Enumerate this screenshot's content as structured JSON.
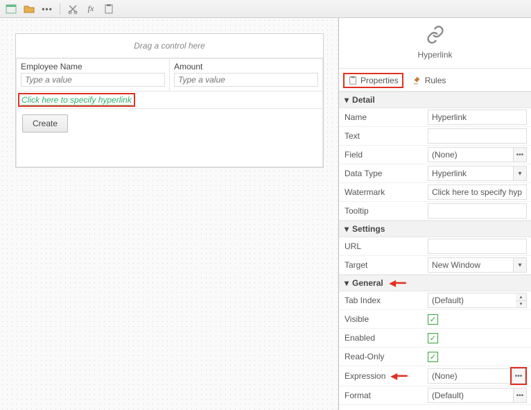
{
  "panel": {
    "title": "Hyperlink",
    "tabs": {
      "properties": "Properties",
      "rules": "Rules"
    }
  },
  "sections": {
    "detail": "Detail",
    "settings": "Settings",
    "general": "General"
  },
  "props": {
    "name": {
      "label": "Name",
      "value": "Hyperlink"
    },
    "text": {
      "label": "Text",
      "value": ""
    },
    "field": {
      "label": "Field",
      "value": "(None)"
    },
    "dataType": {
      "label": "Data Type",
      "value": "Hyperlink"
    },
    "watermark": {
      "label": "Watermark",
      "value": "Click here to specify hyp"
    },
    "tooltip": {
      "label": "Tooltip",
      "value": ""
    },
    "url": {
      "label": "URL",
      "value": ""
    },
    "target": {
      "label": "Target",
      "value": "New Window"
    },
    "tabIndex": {
      "label": "Tab Index",
      "value": "(Default)"
    },
    "visible": {
      "label": "Visible"
    },
    "enabled": {
      "label": "Enabled"
    },
    "readOnly": {
      "label": "Read-Only"
    },
    "expression": {
      "label": "Expression",
      "value": "(None)"
    },
    "format": {
      "label": "Format",
      "value": "(Default)"
    }
  },
  "canvas": {
    "dropHint": "Drag a control here",
    "fields": {
      "employee": {
        "label": "Employee Name",
        "placeholder": "Type a value"
      },
      "amount": {
        "label": "Amount",
        "placeholder": "Type a value"
      }
    },
    "hyperlinkText": "Click here to specify hyperlink",
    "createBtn": "Create"
  },
  "icons": {
    "ellipsis": "•••",
    "check": "✓",
    "chevDown": "▾",
    "chevUp": "▴"
  }
}
